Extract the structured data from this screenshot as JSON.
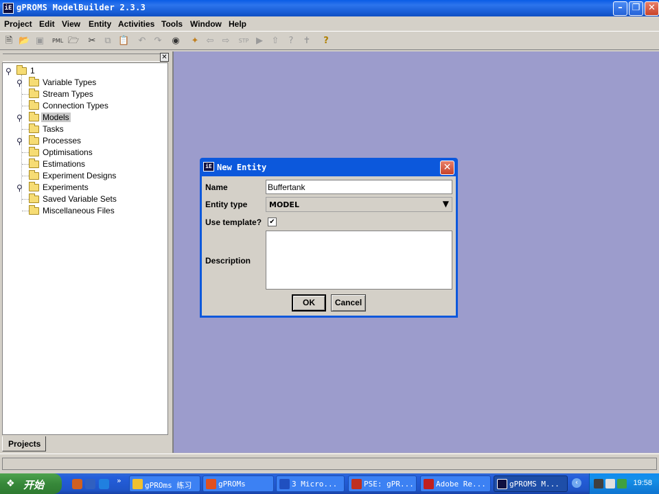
{
  "window": {
    "title": "gPROMS ModelBuilder 2.3.3",
    "icon_text": "iE"
  },
  "menu": [
    "Project",
    "Edit",
    "View",
    "Entity",
    "Activities",
    "Tools",
    "Window",
    "Help"
  ],
  "toolbar_icons": [
    "new-file-icon",
    "open-folder-icon",
    "save-icon",
    "pml-icon",
    "open-project-icon",
    "cut-icon",
    "copy-icon",
    "paste-icon",
    "undo-icon",
    "redo-icon",
    "find-icon",
    "tool-icon",
    "back-icon",
    "forward-icon",
    "stp-icon",
    "run-icon",
    "up-icon",
    "help-query-icon",
    "wand-icon",
    "help-icon"
  ],
  "tree": {
    "root_label": "1",
    "items": [
      {
        "label": "Variable Types",
        "expandable": true
      },
      {
        "label": "Stream Types",
        "expandable": false
      },
      {
        "label": "Connection Types",
        "expandable": false
      },
      {
        "label": "Models",
        "expandable": true,
        "selected": true
      },
      {
        "label": "Tasks",
        "expandable": false
      },
      {
        "label": "Processes",
        "expandable": true
      },
      {
        "label": "Optimisations",
        "expandable": false
      },
      {
        "label": "Estimations",
        "expandable": false
      },
      {
        "label": "Experiment Designs",
        "expandable": false
      },
      {
        "label": "Experiments",
        "expandable": true
      },
      {
        "label": "Saved Variable Sets",
        "expandable": false
      },
      {
        "label": "Miscellaneous Files",
        "expandable": false
      }
    ]
  },
  "projects_tab": "Projects",
  "dialog": {
    "title": "New Entity",
    "name_label": "Name",
    "name_value": "Buffertank",
    "type_label": "Entity type",
    "type_value": "MODEL",
    "template_label": "Use template?",
    "template_checked": true,
    "description_label": "Description",
    "description_value": "",
    "ok_label": "OK",
    "cancel_label": "Cancel"
  },
  "taskbar": {
    "start_label": "开始",
    "tasks": [
      {
        "label": "gPROms 练习",
        "color": "#f0c030"
      },
      {
        "label": "gPROMs",
        "color": "#e05020"
      },
      {
        "label": "3 Micro...",
        "color": "#2050c0"
      },
      {
        "label": "PSE: gPR...",
        "color": "#c03020"
      },
      {
        "label": "Adobe Re...",
        "color": "#c02020"
      },
      {
        "label": "gPROMS M...",
        "color": "#101040"
      }
    ],
    "clock": "19:58"
  },
  "colors": {
    "desktop": "#9c9ccc",
    "titlebar": "#0a5ce6",
    "taskbar": "#245edb"
  }
}
